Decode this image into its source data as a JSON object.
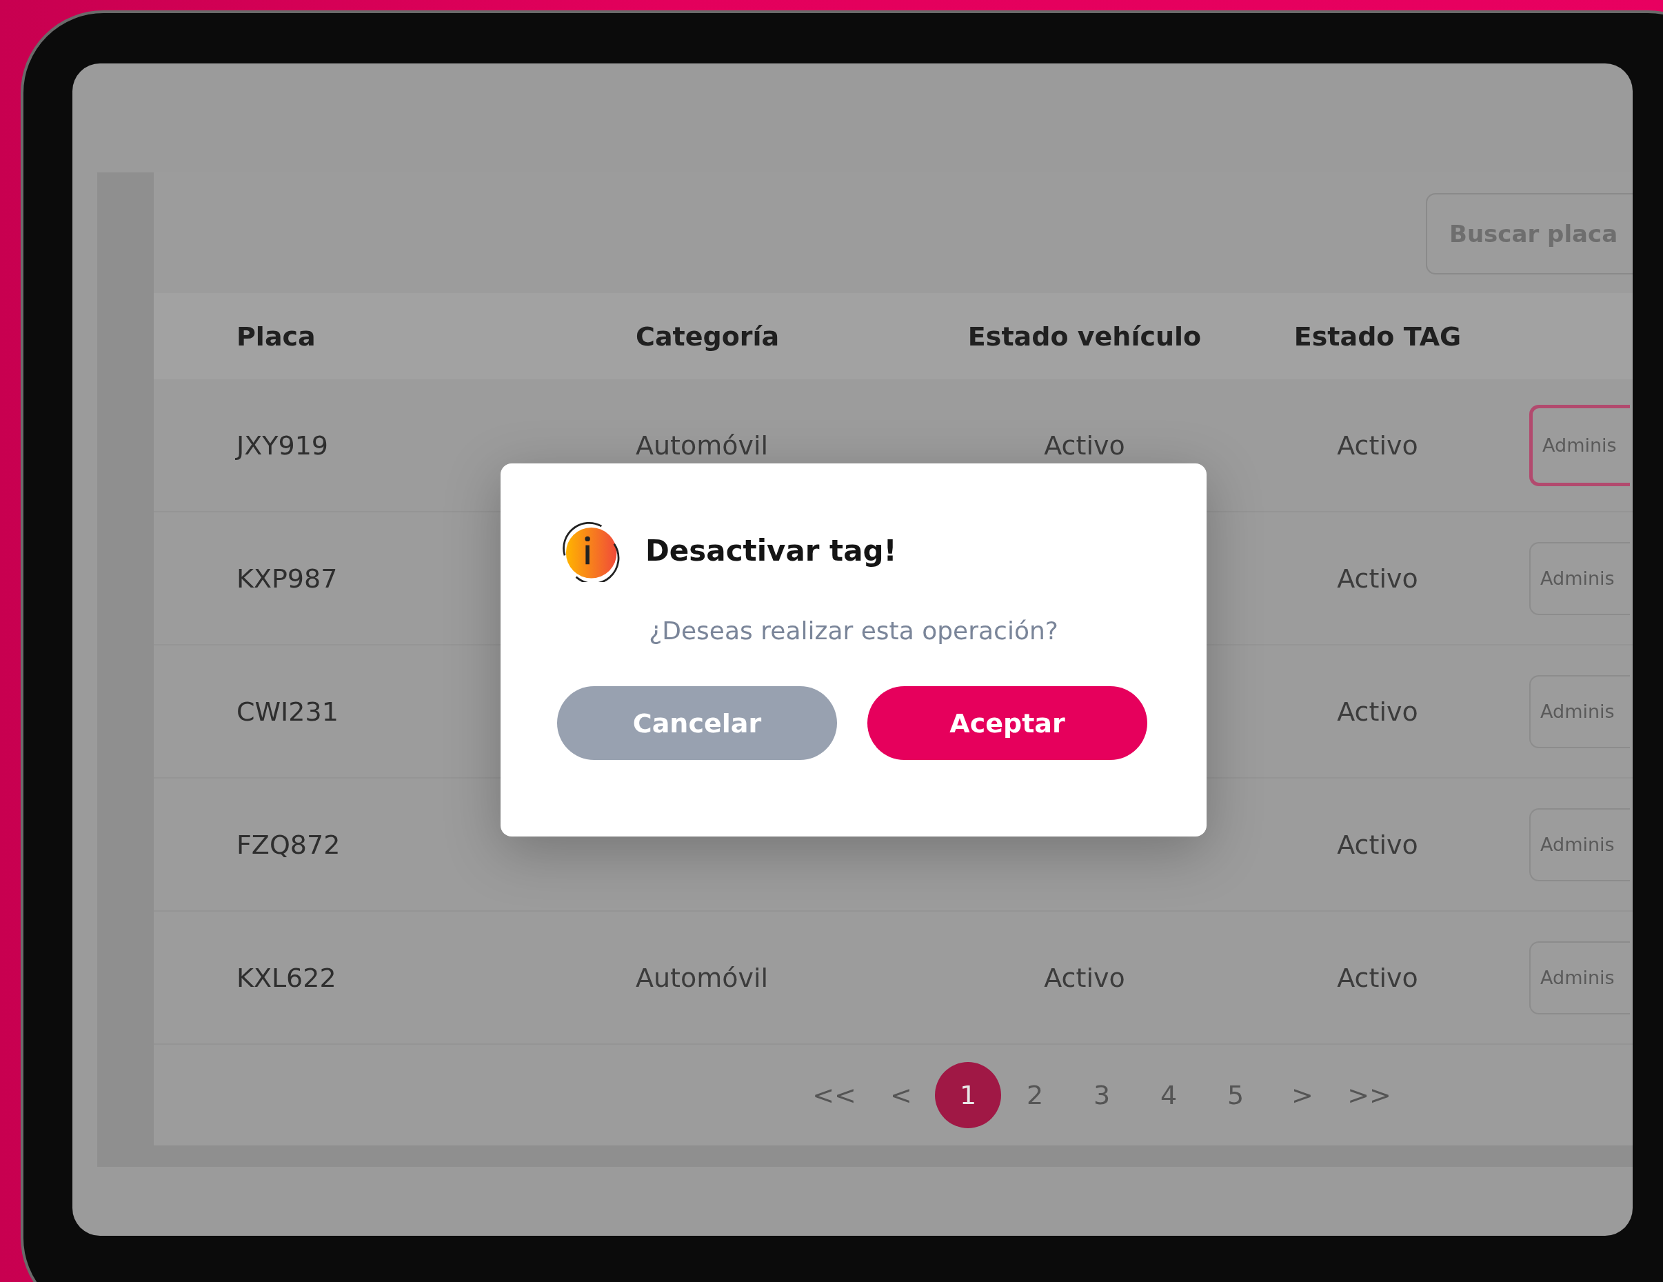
{
  "search": {
    "placeholder": "Buscar placa"
  },
  "table": {
    "columns": [
      "Placa",
      "Categoría",
      "Estado vehículo",
      "Estado TAG"
    ],
    "rows": [
      {
        "placa": "JXY919",
        "categoria": "Automóvil",
        "estado_vehiculo": "Activo",
        "estado_tag": "Activo",
        "action": "Adminis",
        "selected": true
      },
      {
        "placa": "KXP987",
        "estado_tag": "Activo",
        "action": "Adminis",
        "selected": false
      },
      {
        "placa": "CWI231",
        "estado_tag": "Activo",
        "action": "Adminis",
        "selected": false
      },
      {
        "placa": "FZQ872",
        "estado_tag": "Activo",
        "action": "Adminis",
        "selected": false
      },
      {
        "placa": "KXL622",
        "categoria": "Automóvil",
        "estado_vehiculo": "Activo",
        "estado_tag": "Activo",
        "action": "Adminis",
        "selected": false
      }
    ]
  },
  "pagination": {
    "first": "<<",
    "prev": "<",
    "pages": [
      {
        "label": "1",
        "selected": true
      },
      {
        "label": "2",
        "selected": false
      },
      {
        "label": "3",
        "selected": false
      },
      {
        "label": "4",
        "selected": false
      },
      {
        "label": "5",
        "selected": false
      }
    ],
    "next": ">",
    "last": ">>"
  },
  "dialog": {
    "title": "Desactivar tag!",
    "message": "¿Deseas realizar esta operación?",
    "buttons": [
      {
        "label": "Cancelar",
        "kind": "secondary"
      },
      {
        "label": "Aceptar",
        "kind": "primary"
      }
    ]
  }
}
